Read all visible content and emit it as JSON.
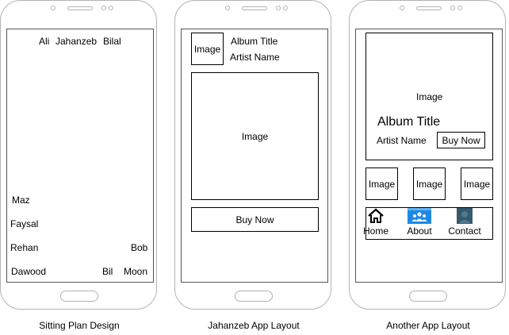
{
  "sitting_plan": {
    "names": [
      "Ali",
      "Jahanzeb",
      "Bilal",
      "Maz",
      "Faysal",
      "Rehan",
      "Bob",
      "Dawood",
      "Bil",
      "Moon"
    ],
    "caption": "Sitting Plan Design"
  },
  "jahanzeb_layout": {
    "thumb_label": "Image",
    "album_title": "Album Title",
    "artist_name": "Artist Name",
    "main_image_label": "Image",
    "buy_label": "Buy Now",
    "caption": "Jahanzeb App Layout"
  },
  "another_layout": {
    "hero_image_label": "Image",
    "album_title": "Album Title",
    "artist_name": "Artist Name",
    "buy_label": "Buy Now",
    "thumbs": [
      "Image",
      "Image",
      "Image"
    ],
    "nav": [
      {
        "label": "Home",
        "icon": "home-icon"
      },
      {
        "label": "About",
        "icon": "users-icon"
      },
      {
        "label": "Contact",
        "icon": "contact-icon"
      }
    ],
    "caption": "Another App Layout"
  },
  "colors": {
    "about_icon": "#1e88e5",
    "contact_icon": "#37596b"
  }
}
